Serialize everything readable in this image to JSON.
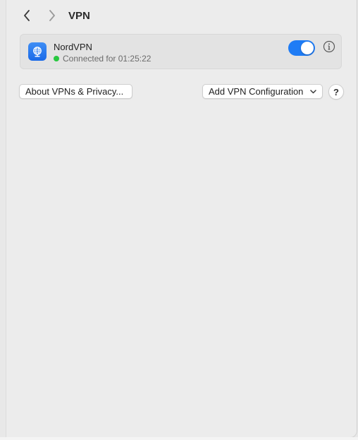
{
  "header": {
    "title": "VPN",
    "back_icon": "chevron-left-icon",
    "forward_icon": "chevron-right-icon"
  },
  "vpn": {
    "name": "NordVPN",
    "status": "Connected for 01:25:22",
    "status_color": "#28c840",
    "enabled": true,
    "toggle_color": "#1f7cf5",
    "icon": "globe-icon",
    "info_icon": "info-circle-icon"
  },
  "actions": {
    "about_label": "About VPNs & Privacy...",
    "add_label": "Add VPN Configuration",
    "help_label": "?"
  }
}
